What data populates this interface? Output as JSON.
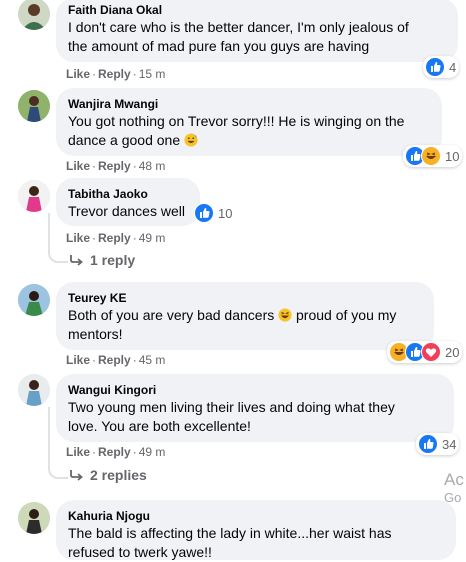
{
  "colors": {
    "bubble": "#f0f2f5",
    "meta": "#65676b",
    "like_blue": "#1877f2",
    "love_red": "#f33e58",
    "haha_yellow": "#f7b125"
  },
  "comments": [
    {
      "name": "Faith Diana Okal",
      "lines": [
        "I don't care who is the better dancer, I'm only jealous of",
        "the amount of mad pure fan you guys are having"
      ],
      "actions": {
        "like": "Like",
        "reply": "Reply",
        "time": "15 m"
      },
      "reactions": {
        "icons": [
          "like-icon"
        ],
        "count": "4"
      }
    },
    {
      "name": "Wanjira Mwangi",
      "lines": [
        "You got nothing on Trevor sorry!!! He is winging on the",
        "dance a good one"
      ],
      "emoji": "grinning-sweat-emoji",
      "actions": {
        "like": "Like",
        "reply": "Reply",
        "time": "48 m"
      },
      "reactions": {
        "icons": [
          "like-icon",
          "haha-icon"
        ],
        "count": "10"
      }
    },
    {
      "name": "Tabitha Jaoko",
      "lines": [
        "Trevor dances well"
      ],
      "actions": {
        "like": "Like",
        "reply": "Reply",
        "time": "49 m"
      },
      "reactions": {
        "icons": [
          "like-icon"
        ],
        "count": "10"
      },
      "replies": "1 reply"
    },
    {
      "name": "Teurey KE",
      "lines": [
        "Both of you are very bad dancers",
        "proud of you my",
        "mentors!"
      ],
      "emoji": "laughing-emoji",
      "actions": {
        "like": "Like",
        "reply": "Reply",
        "time": "45 m"
      },
      "reactions": {
        "icons": [
          "haha-icon",
          "like-icon",
          "love-icon"
        ],
        "count": "20"
      }
    },
    {
      "name": "Wangui Kingori",
      "lines": [
        "Two young men living their lives and doing what they",
        "love. You are both excellente!"
      ],
      "actions": {
        "like": "Like",
        "reply": "Reply",
        "time": "49 m"
      },
      "reactions": {
        "icons": [
          "like-icon"
        ],
        "count": "34"
      },
      "replies": "2 replies"
    },
    {
      "name": "Kahuria Njogu",
      "lines": [
        "The bald is affecting the lady in white...her waist has",
        "refused to twerk yawe!!"
      ]
    }
  ],
  "activation_watermark": {
    "line1": "Ac",
    "line2": "Go"
  }
}
